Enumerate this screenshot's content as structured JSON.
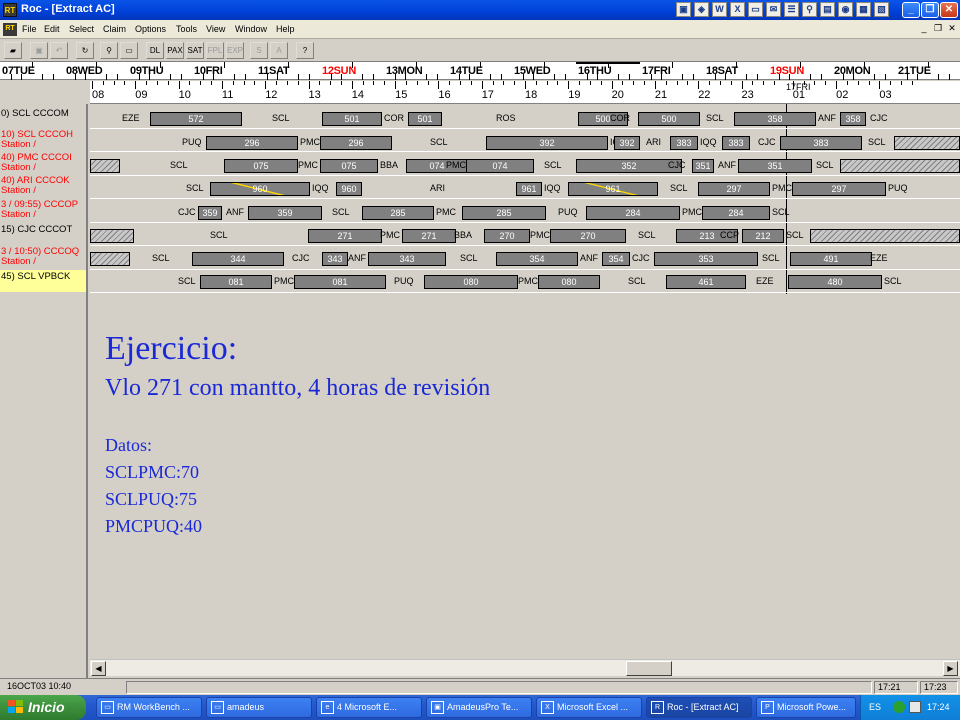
{
  "window": {
    "title": "Roc - [Extract AC]",
    "logo_text": "RT"
  },
  "menu": [
    "File",
    "Edit",
    "Select",
    "Claim",
    "Options",
    "Tools",
    "View",
    "Window",
    "Help"
  ],
  "toolbar": {
    "buttons": [
      "open",
      "save",
      "undo",
      "refresh",
      "find",
      "zoom",
      "DL",
      "PAX",
      "SAT",
      "FPL",
      "EXP",
      "S",
      "A",
      "?"
    ]
  },
  "timeline": {
    "days": [
      {
        "label": "07TUE",
        "highlight": false
      },
      {
        "label": "08WED",
        "highlight": false
      },
      {
        "label": "09THU",
        "highlight": false
      },
      {
        "label": "10FRI",
        "highlight": false
      },
      {
        "label": "11SAT",
        "highlight": false
      },
      {
        "label": "12SUN",
        "highlight": true
      },
      {
        "label": "13MON",
        "highlight": false
      },
      {
        "label": "14TUE",
        "highlight": false
      },
      {
        "label": "15WED",
        "highlight": false
      },
      {
        "label": "16THU",
        "highlight": false
      },
      {
        "label": "17FRI",
        "highlight": false
      },
      {
        "label": "18SAT",
        "highlight": false
      },
      {
        "label": "19SUN",
        "highlight": true
      },
      {
        "label": "20MON",
        "highlight": false
      },
      {
        "label": "21TUE",
        "highlight": false
      }
    ],
    "hours": [
      "08",
      "09",
      "10",
      "11",
      "12",
      "13",
      "14",
      "15",
      "16",
      "17",
      "18",
      "19",
      "20",
      "21",
      "22",
      "23",
      "01",
      "02",
      "03"
    ],
    "now_label": "17FRI"
  },
  "rows": [
    {
      "label": "0) SCL  CCCOM",
      "color": "black"
    },
    {
      "label": "10) SCL  CCCOH\nStation /",
      "color": "red"
    },
    {
      "label": "40) PMC  CCCOI\nStation /",
      "color": "red"
    },
    {
      "label": "40) ARI  CCCOK\nStation /",
      "color": "red"
    },
    {
      "label": "3 / 09:55) CCCOP\nStation /",
      "color": "red"
    },
    {
      "label": "15) CJC  CCCOT",
      "color": "black"
    },
    {
      "label": "3 / 10:50) CCCOQ\nStation /",
      "color": "red"
    },
    {
      "label": "45) SCL  VPBCK",
      "color": "black"
    }
  ],
  "gantt": [
    [
      {
        "t": "stn",
        "text": "EZE"
      },
      {
        "t": "bar",
        "text": "572"
      },
      {
        "t": "stn",
        "text": "SCL"
      },
      {
        "t": "bar",
        "text": "501"
      },
      {
        "t": "stn",
        "text": "COR"
      },
      {
        "t": "bar",
        "text": "501"
      },
      {
        "t": "stn",
        "text": "ROS"
      },
      {
        "t": "bar",
        "text": "500"
      },
      {
        "t": "stn",
        "text": "COR"
      },
      {
        "t": "bar",
        "text": "500"
      },
      {
        "t": "stn",
        "text": "SCL"
      },
      {
        "t": "bar",
        "text": "358"
      },
      {
        "t": "stn",
        "text": "ANF"
      },
      {
        "t": "bar",
        "text": "358"
      },
      {
        "t": "stn",
        "text": "CJC"
      }
    ],
    [
      {
        "t": "stn",
        "text": "PUQ"
      },
      {
        "t": "bar",
        "text": "296"
      },
      {
        "t": "stn",
        "text": "PMC"
      },
      {
        "t": "bar",
        "text": "296"
      },
      {
        "t": "stn",
        "text": "SCL"
      },
      {
        "t": "bar",
        "text": "392"
      },
      {
        "t": "stn",
        "text": "IQQ"
      },
      {
        "t": "bar",
        "text": "392"
      },
      {
        "t": "stn",
        "text": "ARI"
      },
      {
        "t": "bar",
        "text": "383"
      },
      {
        "t": "stn",
        "text": "IQQ"
      },
      {
        "t": "bar",
        "text": "383"
      },
      {
        "t": "stn",
        "text": "CJC"
      },
      {
        "t": "bar",
        "text": "383"
      },
      {
        "t": "stn",
        "text": "SCL"
      }
    ],
    [
      {
        "t": "stn",
        "text": "SCL"
      },
      {
        "t": "bar",
        "text": "075"
      },
      {
        "t": "stn",
        "text": "PMC"
      },
      {
        "t": "bar",
        "text": "075"
      },
      {
        "t": "stn",
        "text": "BBA"
      },
      {
        "t": "bar",
        "text": "074"
      },
      {
        "t": "stn",
        "text": "PMC"
      },
      {
        "t": "bar",
        "text": "074"
      },
      {
        "t": "stn",
        "text": "SCL"
      },
      {
        "t": "bar",
        "text": "352"
      },
      {
        "t": "stn",
        "text": "CJC"
      },
      {
        "t": "bar",
        "text": "351"
      },
      {
        "t": "stn",
        "text": "ANF"
      },
      {
        "t": "bar",
        "text": "351"
      },
      {
        "t": "stn",
        "text": "SCL"
      }
    ],
    [
      {
        "t": "stn",
        "text": "SCL"
      },
      {
        "t": "bar",
        "text": "960"
      },
      {
        "t": "stn",
        "text": "IQQ"
      },
      {
        "t": "bar",
        "text": "960"
      },
      {
        "t": "stn",
        "text": "ARI"
      },
      {
        "t": "bar",
        "text": "961"
      },
      {
        "t": "stn",
        "text": "IQQ"
      },
      {
        "t": "bar",
        "text": "961"
      },
      {
        "t": "stn",
        "text": "SCL"
      },
      {
        "t": "bar",
        "text": "297"
      },
      {
        "t": "stn",
        "text": "PMC"
      },
      {
        "t": "bar",
        "text": "297"
      },
      {
        "t": "stn",
        "text": "PUQ"
      }
    ],
    [
      {
        "t": "stn",
        "text": "CJC"
      },
      {
        "t": "bar",
        "text": "359"
      },
      {
        "t": "stn",
        "text": "ANF"
      },
      {
        "t": "bar",
        "text": "359"
      },
      {
        "t": "stn",
        "text": "SCL"
      },
      {
        "t": "bar",
        "text": "285"
      },
      {
        "t": "stn",
        "text": "PMC"
      },
      {
        "t": "bar",
        "text": "285"
      },
      {
        "t": "stn",
        "text": "PUQ"
      },
      {
        "t": "bar",
        "text": "284"
      },
      {
        "t": "stn",
        "text": "PMC"
      },
      {
        "t": "bar",
        "text": "284"
      },
      {
        "t": "stn",
        "text": "SCL"
      }
    ],
    [
      {
        "t": "stn",
        "text": "SCL"
      },
      {
        "t": "bar",
        "text": "271"
      },
      {
        "t": "stn",
        "text": "PMC"
      },
      {
        "t": "bar",
        "text": "271"
      },
      {
        "t": "stn",
        "text": "BBA"
      },
      {
        "t": "bar",
        "text": "270"
      },
      {
        "t": "stn",
        "text": "PMC"
      },
      {
        "t": "bar",
        "text": "270"
      },
      {
        "t": "stn",
        "text": "SCL"
      },
      {
        "t": "bar",
        "text": "213"
      },
      {
        "t": "stn",
        "text": "CCP"
      },
      {
        "t": "bar",
        "text": "212"
      },
      {
        "t": "stn",
        "text": "SCL"
      }
    ],
    [
      {
        "t": "stn",
        "text": "SCL"
      },
      {
        "t": "bar",
        "text": "344"
      },
      {
        "t": "stn",
        "text": "CJC"
      },
      {
        "t": "bar",
        "text": "343"
      },
      {
        "t": "stn",
        "text": "ANF"
      },
      {
        "t": "bar",
        "text": "343"
      },
      {
        "t": "stn",
        "text": "SCL"
      },
      {
        "t": "bar",
        "text": "354"
      },
      {
        "t": "stn",
        "text": "ANF"
      },
      {
        "t": "bar",
        "text": "354"
      },
      {
        "t": "stn",
        "text": "CJC"
      },
      {
        "t": "bar",
        "text": "353"
      },
      {
        "t": "stn",
        "text": "SCL"
      },
      {
        "t": "bar",
        "text": "491"
      },
      {
        "t": "stn",
        "text": "EZE"
      }
    ],
    [
      {
        "t": "stn",
        "text": "SCL"
      },
      {
        "t": "bar",
        "text": "081"
      },
      {
        "t": "stn",
        "text": "PMC"
      },
      {
        "t": "bar",
        "text": "081"
      },
      {
        "t": "stn",
        "text": "PUQ"
      },
      {
        "t": "bar",
        "text": "080"
      },
      {
        "t": "stn",
        "text": "PMC"
      },
      {
        "t": "bar",
        "text": "080"
      },
      {
        "t": "stn",
        "text": "SCL"
      },
      {
        "t": "bar",
        "text": "461"
      },
      {
        "t": "stn",
        "text": "EZE"
      },
      {
        "t": "bar",
        "text": "480"
      },
      {
        "t": "stn",
        "text": "SCL"
      }
    ]
  ],
  "exercise": {
    "title": "Ejercicio:",
    "subtitle": "Vlo 271 con mantto, 4 horas de revisión",
    "datos_label": "Datos:",
    "datos": [
      "SCLPMC:70",
      "SCLPUQ:75",
      "PMCPUQ:40"
    ]
  },
  "status": {
    "left": "16OCT03 10:40",
    "time1": "17:21",
    "time2": "17:23"
  },
  "taskbar": {
    "start": "Inicio",
    "tasks": [
      {
        "label": "RM WorkBench ...",
        "icon": "window-icon",
        "active": false
      },
      {
        "label": "amadeus",
        "icon": "window-icon",
        "active": false
      },
      {
        "label": "4 Microsoft E...",
        "icon": "ie-icon",
        "active": false
      },
      {
        "label": "AmadeusPro Te...",
        "icon": "terminal-icon",
        "active": false
      },
      {
        "label": "Microsoft Excel ...",
        "icon": "excel-icon",
        "active": false
      },
      {
        "label": "Roc - [Extract AC]",
        "icon": "roc-icon",
        "active": true
      },
      {
        "label": "Microsoft Powe...",
        "icon": "powerpoint-icon",
        "active": false
      }
    ],
    "tray": {
      "lang": "ES",
      "clock": "17:24"
    }
  }
}
